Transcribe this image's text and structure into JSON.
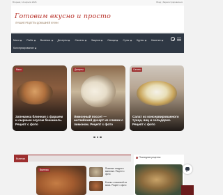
{
  "topbar": {
    "date": "Вторник, 14 апреля 2026",
    "links": "Вход | Зарегистрироваться"
  },
  "header": {
    "logo": "Готовим вкусно и просто",
    "tagline": "ЛУЧШИЕ РЕЦЕПТЫ ДОМАШНЕЙ КУХНИ"
  },
  "nav": {
    "row1": [
      "Мясо",
      "Рыба",
      "Выпечка",
      "Десерты",
      "Салаты",
      "Закуски",
      "Овощи",
      "Супы",
      "Крупы",
      "Напитки"
    ],
    "row2": [
      "Консервирование"
    ]
  },
  "slider": {
    "cards": [
      {
        "badge": "Мясо",
        "title": "Запеканка блинная с фаршем и сырным соусом бешамель. Рецепт с фото"
      },
      {
        "badge": "Десерты",
        "title": "Лимонный поссет — английский десерт из сливок с лимоном. Рецепт с фото"
      },
      {
        "badge": "Салаты",
        "title": "Салат из консервированного тунца, яиц и сельдерея. Рецепт с фото"
      }
    ]
  },
  "section": {
    "label": "Выпечка",
    "main_badge": "Выпечка",
    "items": [
      "Пышные оладьи с ванилью. Рецепт с фото",
      "Блины с начинкой из мяса. Рецепт с фото"
    ]
  },
  "sidebar": {
    "heading": "Последние рецепты"
  },
  "colors": {
    "accent": "#9d2f2f",
    "nav_bg": "#2f3844",
    "page_bg": "#f2f2f2"
  }
}
